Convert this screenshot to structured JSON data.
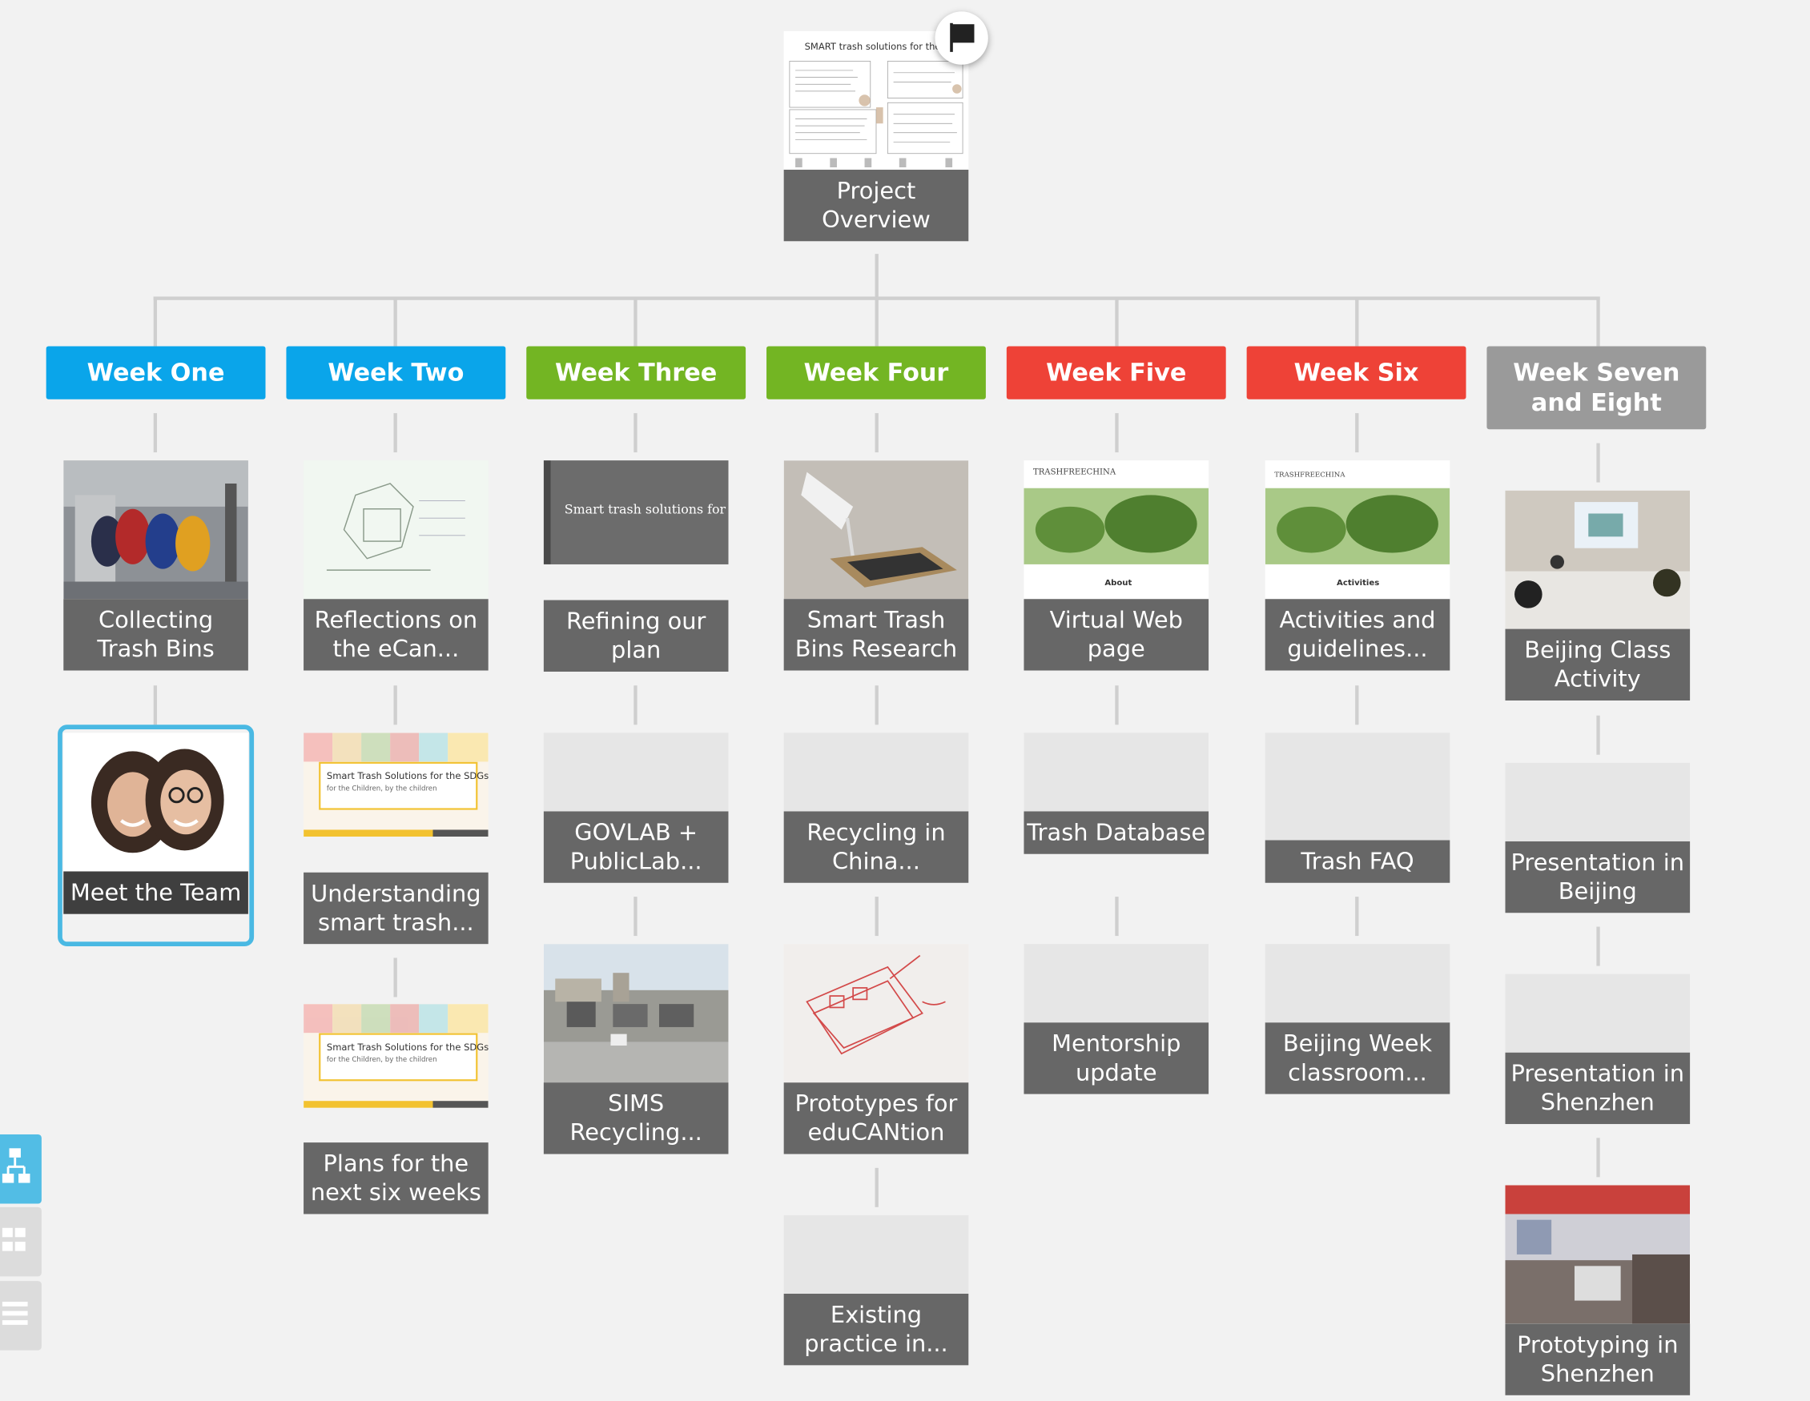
{
  "root": {
    "label": "Project Overview",
    "thumb_title": "SMART trash solutions for the SDGs"
  },
  "weeks": [
    {
      "label": "Week One",
      "color": "#0aa5ea"
    },
    {
      "label": "Week Two",
      "color": "#0aa5ea"
    },
    {
      "label": "Week Three",
      "color": "#73b523"
    },
    {
      "label": "Week Four",
      "color": "#73b523"
    },
    {
      "label": "Week Five",
      "color": "#ee4237"
    },
    {
      "label": "Week Six",
      "color": "#ee4237"
    },
    {
      "label": "Week Seven and Eight",
      "color": "#9a9a9a"
    }
  ],
  "cards": {
    "w1": [
      "Collecting Trash Bins",
      "Meet the Team"
    ],
    "w2": [
      "Reflections on the eCan...",
      "Understanding smart trash...",
      "Plans for the next six weeks"
    ],
    "w3": [
      "Refining our plan",
      "GOVLAB + PublicLab...",
      "SIMS Recycling..."
    ],
    "w4": [
      "Smart Trash Bins Research",
      "Recycling in China...",
      "Prototypes for eduCANtion",
      "Existing practice in..."
    ],
    "w5": [
      "Virtual Web page",
      "Trash Database",
      "Mentorship update"
    ],
    "w6": [
      "Activities and guidelines...",
      "Trash FAQ",
      "Beijing Week classroom..."
    ],
    "w7": [
      "Beijing Class Activity",
      "Presentation in Beijing",
      "Presentation in Shenzhen",
      "Prototyping in Shenzhen"
    ]
  },
  "thumb_text": {
    "sdg_slide": "Smart trash solutions for the SDGs",
    "sdg_slide2": "Smart Trash Solutions for the SDGs",
    "sdg_sub": "for the Children, by the children",
    "trashfree": "TRASHFREECHINA",
    "about": "About",
    "activities": "Activities"
  },
  "toolbar": {
    "items": [
      "tree-view",
      "grid-view",
      "list-view"
    ]
  },
  "selected_card": "Meet the Team"
}
